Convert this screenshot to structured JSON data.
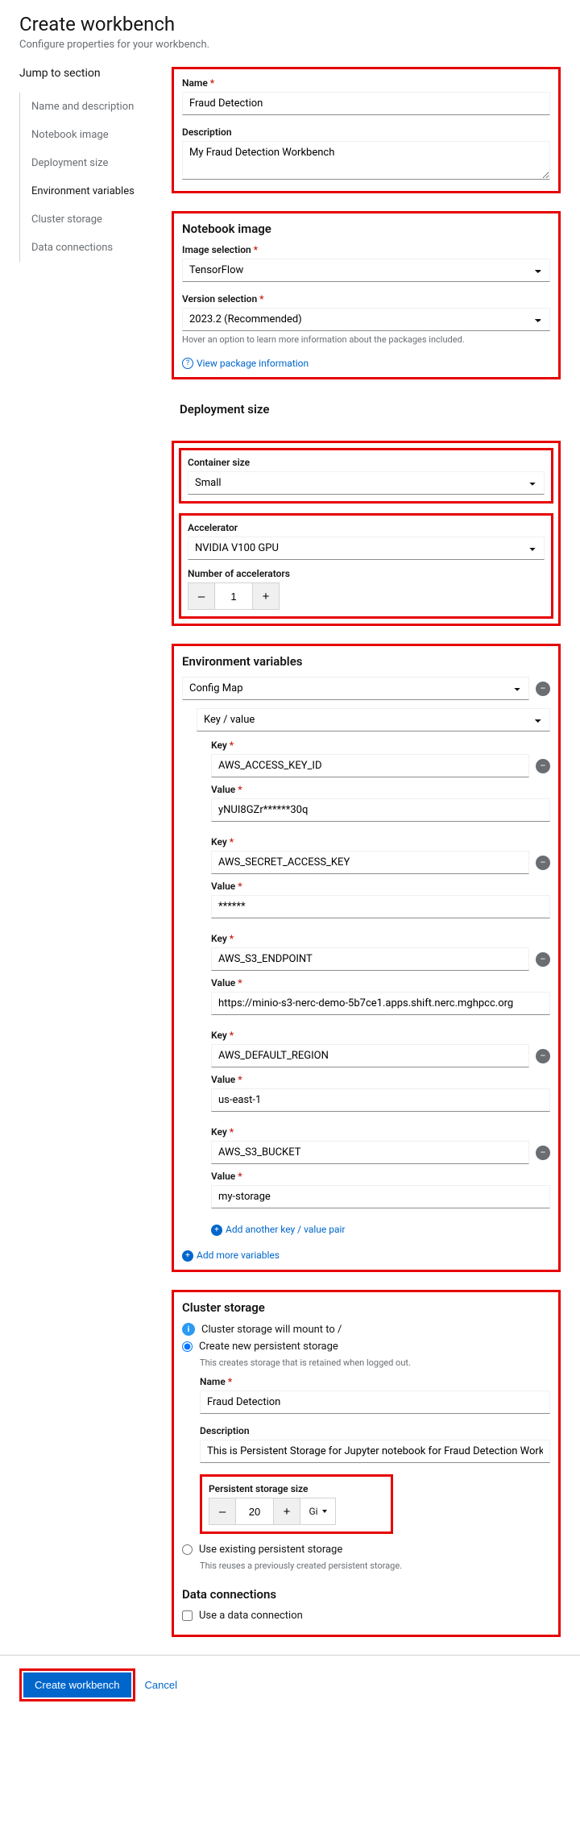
{
  "header": {
    "title": "Create workbench",
    "subtitle": "Configure properties for your workbench."
  },
  "sidebar": {
    "title": "Jump to section",
    "items": [
      {
        "label": "Name and description"
      },
      {
        "label": "Notebook image"
      },
      {
        "label": "Deployment size"
      },
      {
        "label": "Environment variables"
      },
      {
        "label": "Cluster storage"
      },
      {
        "label": "Data connections"
      }
    ]
  },
  "name_desc": {
    "name_label": "Name",
    "name_value": "Fraud Detection",
    "desc_label": "Description",
    "desc_value": "My Fraud Detection Workbench"
  },
  "notebook_image": {
    "heading": "Notebook image",
    "image_label": "Image selection",
    "image_value": "TensorFlow",
    "version_label": "Version selection",
    "version_value": "2023.2 (Recommended)",
    "helper": "Hover an option to learn more information about the packages included.",
    "link": "View package information"
  },
  "deployment_size": {
    "heading": "Deployment size",
    "container_label": "Container size",
    "container_value": "Small",
    "accel_label": "Accelerator",
    "accel_value": "NVIDIA V100 GPU",
    "num_accel_label": "Number of accelerators",
    "num_accel_value": "1"
  },
  "env_vars": {
    "heading": "Environment variables",
    "type_value": "Config Map",
    "subtype_value": "Key / value",
    "key_label": "Key",
    "value_label": "Value",
    "pairs": [
      {
        "key": "AWS_ACCESS_KEY_ID",
        "value": "yNUI8GZr******30q"
      },
      {
        "key": "AWS_SECRET_ACCESS_KEY",
        "value": "******"
      },
      {
        "key": "AWS_S3_ENDPOINT",
        "value": "https://minio-s3-nerc-demo-5b7ce1.apps.shift.nerc.mghpcc.org"
      },
      {
        "key": "AWS_DEFAULT_REGION",
        "value": "us-east-1"
      },
      {
        "key": "AWS_S3_BUCKET",
        "value": "my-storage"
      }
    ],
    "add_pair": "Add another key / value pair",
    "add_more": "Add more variables"
  },
  "cluster_storage": {
    "heading": "Cluster storage",
    "mount_info": "Cluster storage will mount to /",
    "create_new": "Create new persistent storage",
    "create_helper": "This creates storage that is retained when logged out.",
    "name_label": "Name",
    "name_value": "Fraud Detection",
    "desc_label": "Description",
    "desc_value": "This is Persistent Storage for Jupyter notebook for Fraud Detection Workbench.",
    "size_label": "Persistent storage size",
    "size_value": "20",
    "size_unit": "Gi",
    "use_existing": "Use existing persistent storage",
    "existing_helper": "This reuses a previously created persistent storage."
  },
  "data_conn": {
    "heading": "Data connections",
    "use_label": "Use a data connection"
  },
  "footer": {
    "create": "Create workbench",
    "cancel": "Cancel"
  }
}
